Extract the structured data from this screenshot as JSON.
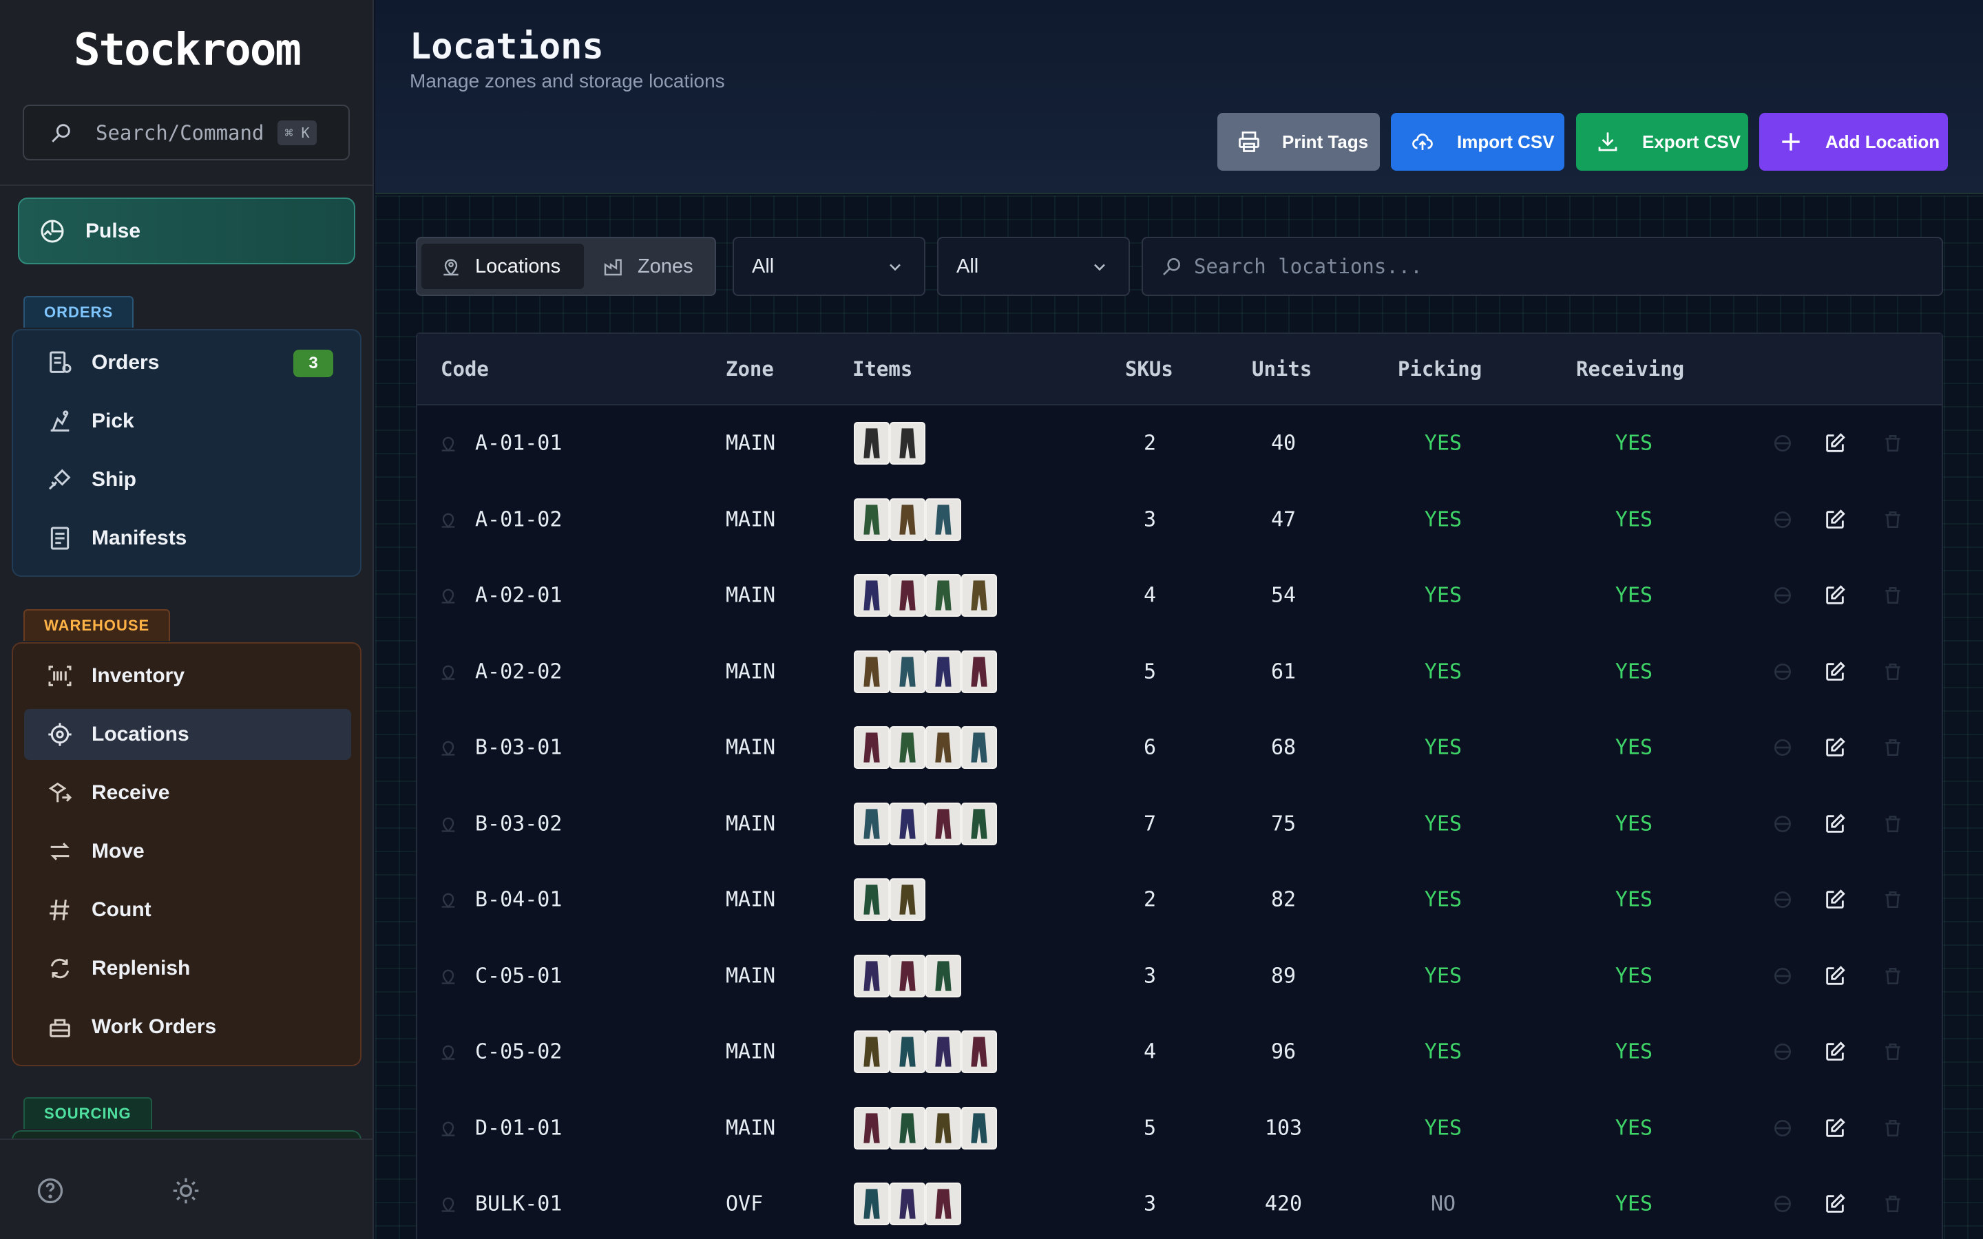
{
  "app": {
    "brand": "Stockroom"
  },
  "sidebar": {
    "search_label": "Search/Command",
    "search_kbd": "⌘ K",
    "pulse_label": "Pulse",
    "sections": {
      "orders": "ORDERS",
      "warehouse": "WAREHOUSE",
      "sourcing": "SOURCING"
    },
    "orders_items": [
      {
        "label": "Orders",
        "badge": "3"
      },
      {
        "label": "Pick"
      },
      {
        "label": "Ship"
      },
      {
        "label": "Manifests"
      }
    ],
    "warehouse_items": [
      {
        "label": "Inventory"
      },
      {
        "label": "Locations"
      },
      {
        "label": "Receive"
      },
      {
        "label": "Move"
      },
      {
        "label": "Count"
      },
      {
        "label": "Replenish"
      },
      {
        "label": "Work Orders"
      }
    ]
  },
  "header": {
    "title": "Locations",
    "subtitle": "Manage zones and storage locations",
    "buttons": {
      "print": "Print Tags",
      "import": "Import CSV",
      "export": "Export CSV",
      "add": "Add Location"
    }
  },
  "toolbar": {
    "toggle": {
      "locations": "Locations",
      "zones": "Zones"
    },
    "filter1": "All",
    "filter2": "All",
    "search_placeholder": "Search locations..."
  },
  "table": {
    "columns": [
      "Code",
      "Zone",
      "Items",
      "SKUs",
      "Units",
      "Picking",
      "Receiving"
    ],
    "rows": [
      {
        "code": "A-01-01",
        "zone": "MAIN",
        "thumbs": [
          "#2d2d2d",
          "#2d2d2d"
        ],
        "skus": "2",
        "units": "40",
        "picking": "YES",
        "receiving": "YES"
      },
      {
        "code": "A-01-02",
        "zone": "MAIN",
        "thumbs": [
          "#2f5a38",
          "#5c4526",
          "#2c5564"
        ],
        "skus": "3",
        "units": "47",
        "picking": "YES",
        "receiving": "YES"
      },
      {
        "code": "A-02-01",
        "zone": "MAIN",
        "thumbs": [
          "#2e2d63",
          "#5a2436",
          "#2f5a38",
          "#5a4a26"
        ],
        "skus": "4",
        "units": "54",
        "picking": "YES",
        "receiving": "YES"
      },
      {
        "code": "A-02-02",
        "zone": "MAIN",
        "thumbs": [
          "#5c4526",
          "#2c5564",
          "#2e2d63",
          "#5a2436"
        ],
        "skus": "5",
        "units": "61",
        "picking": "YES",
        "receiving": "YES"
      },
      {
        "code": "B-03-01",
        "zone": "MAIN",
        "thumbs": [
          "#5a2436",
          "#2f5a38",
          "#5c4526",
          "#2c5564"
        ],
        "skus": "6",
        "units": "68",
        "picking": "YES",
        "receiving": "YES"
      },
      {
        "code": "B-03-02",
        "zone": "MAIN",
        "thumbs": [
          "#2c5564",
          "#2e2d63",
          "#5a2436",
          "#235238"
        ],
        "skus": "7",
        "units": "75",
        "picking": "YES",
        "receiving": "YES"
      },
      {
        "code": "B-04-01",
        "zone": "MAIN",
        "thumbs": [
          "#235238",
          "#4e4320"
        ],
        "skus": "2",
        "units": "82",
        "picking": "YES",
        "receiving": "YES"
      },
      {
        "code": "C-05-01",
        "zone": "MAIN",
        "thumbs": [
          "#342a5c",
          "#5a2436",
          "#235238"
        ],
        "skus": "3",
        "units": "89",
        "picking": "YES",
        "receiving": "YES"
      },
      {
        "code": "C-05-02",
        "zone": "MAIN",
        "thumbs": [
          "#4e4320",
          "#1f4e58",
          "#342a5c",
          "#5a2436"
        ],
        "skus": "4",
        "units": "96",
        "picking": "YES",
        "receiving": "YES"
      },
      {
        "code": "D-01-01",
        "zone": "MAIN",
        "thumbs": [
          "#5a2436",
          "#235238",
          "#4e4320",
          "#1f4e58"
        ],
        "skus": "5",
        "units": "103",
        "picking": "YES",
        "receiving": "YES"
      },
      {
        "code": "BULK-01",
        "zone": "OVF",
        "thumbs": [
          "#1f4e58",
          "#342a5c",
          "#5a2436"
        ],
        "skus": "3",
        "units": "420",
        "picking": "NO",
        "receiving": "YES"
      }
    ]
  },
  "colors": {
    "print_btn": "#5f6b80",
    "import_btn": "#2273e8",
    "export_btn": "#13a05a",
    "add_btn": "#7a3ff0",
    "yes": "#3fd467",
    "orders_tag": "#7fc6ff",
    "warehouse_tag": "#ffb347",
    "sourcing_tag": "#4fe0a0"
  }
}
